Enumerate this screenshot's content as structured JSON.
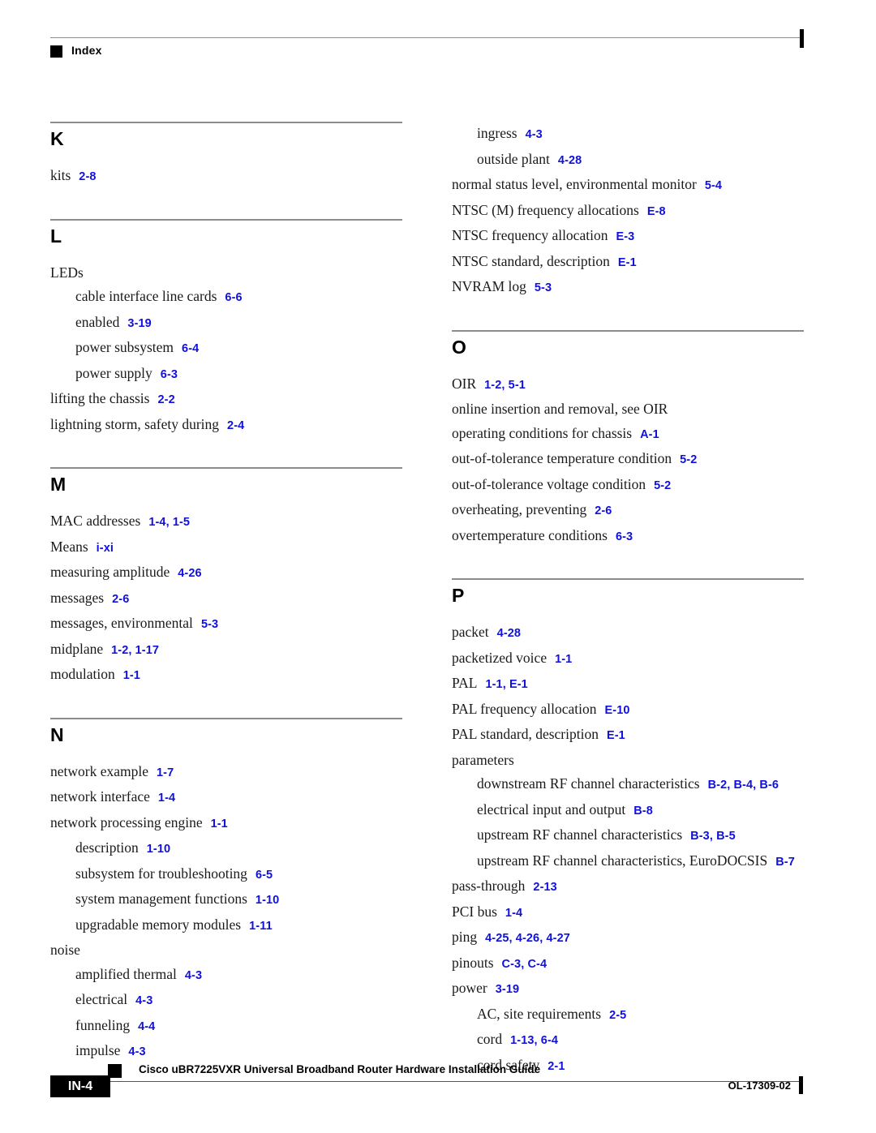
{
  "header": {
    "label": "Index",
    "bullet_icon": "square-bullet-icon"
  },
  "footer": {
    "page_number": "IN-4",
    "guide_title": "Cisco uBR7225VXR Universal Broadband Router Hardware Installation Guide",
    "doc_number": "OL-17309-02",
    "bullet_icon": "square-bullet-icon"
  },
  "colors": {
    "reference_blue": "#1111dd",
    "rule_gray": "#8c8c8c",
    "text_black": "#1a1a1a"
  },
  "columns": {
    "left": [
      {
        "letter": "K",
        "entries": [
          {
            "level": 0,
            "text": "kits",
            "refs": "2-8"
          }
        ]
      },
      {
        "letter": "L",
        "entries": [
          {
            "level": 0,
            "text": "LEDs",
            "refs": ""
          },
          {
            "level": 1,
            "text": "cable interface line cards",
            "refs": "6-6"
          },
          {
            "level": 1,
            "text": "enabled",
            "refs": "3-19"
          },
          {
            "level": 1,
            "text": "power subsystem",
            "refs": "6-4"
          },
          {
            "level": 1,
            "text": "power supply",
            "refs": "6-3"
          },
          {
            "level": 0,
            "text": "lifting the chassis",
            "refs": "2-2"
          },
          {
            "level": 0,
            "text": "lightning storm, safety during",
            "refs": "2-4"
          }
        ]
      },
      {
        "letter": "M",
        "entries": [
          {
            "level": 0,
            "text": "MAC addresses",
            "refs": "1-4, 1-5"
          },
          {
            "level": 0,
            "text": "Means",
            "refs": "i-xi"
          },
          {
            "level": 0,
            "text": "measuring amplitude",
            "refs": "4-26"
          },
          {
            "level": 0,
            "text": "messages",
            "refs": "2-6"
          },
          {
            "level": 0,
            "text": "messages, environmental",
            "refs": "5-3"
          },
          {
            "level": 0,
            "text": "midplane",
            "refs": "1-2, 1-17"
          },
          {
            "level": 0,
            "text": "modulation",
            "refs": "1-1"
          }
        ]
      },
      {
        "letter": "N",
        "entries": [
          {
            "level": 0,
            "text": "network example",
            "refs": "1-7"
          },
          {
            "level": 0,
            "text": "network interface",
            "refs": "1-4"
          },
          {
            "level": 0,
            "text": "network processing engine",
            "refs": "1-1"
          },
          {
            "level": 1,
            "text": "description",
            "refs": "1-10"
          },
          {
            "level": 1,
            "text": "subsystem for troubleshooting",
            "refs": "6-5"
          },
          {
            "level": 1,
            "text": "system management functions",
            "refs": "1-10"
          },
          {
            "level": 1,
            "text": "upgradable memory modules",
            "refs": "1-11"
          },
          {
            "level": 0,
            "text": "noise",
            "refs": ""
          },
          {
            "level": 1,
            "text": "amplified thermal",
            "refs": "4-3"
          },
          {
            "level": 1,
            "text": "electrical",
            "refs": "4-3"
          },
          {
            "level": 1,
            "text": "funneling",
            "refs": "4-4"
          },
          {
            "level": 1,
            "text": "impulse",
            "refs": "4-3"
          }
        ]
      }
    ],
    "right": [
      {
        "letter": "",
        "entries": [
          {
            "level": 1,
            "text": "ingress",
            "refs": "4-3"
          },
          {
            "level": 1,
            "text": "outside plant",
            "refs": "4-28"
          },
          {
            "level": 0,
            "text": "normal status level, environmental monitor",
            "refs": "5-4"
          },
          {
            "level": 0,
            "text": "NTSC (M) frequency allocations",
            "refs": "E-8"
          },
          {
            "level": 0,
            "text": "NTSC frequency allocation",
            "refs": "E-3"
          },
          {
            "level": 0,
            "text": "NTSC standard, description",
            "refs": "E-1"
          },
          {
            "level": 0,
            "text": "NVRAM log",
            "refs": "5-3"
          }
        ]
      },
      {
        "letter": "O",
        "entries": [
          {
            "level": 0,
            "text": "OIR",
            "refs": "1-2, 5-1"
          },
          {
            "level": 0,
            "text": "online insertion and removal, see OIR",
            "refs": ""
          },
          {
            "level": 0,
            "text": "operating conditions for chassis",
            "refs": "A-1"
          },
          {
            "level": 0,
            "text": "out-of-tolerance temperature condition",
            "refs": "5-2"
          },
          {
            "level": 0,
            "text": "out-of-tolerance voltage condition",
            "refs": "5-2"
          },
          {
            "level": 0,
            "text": "overheating, preventing",
            "refs": "2-6"
          },
          {
            "level": 0,
            "text": "overtemperature conditions",
            "refs": "6-3"
          }
        ]
      },
      {
        "letter": "P",
        "entries": [
          {
            "level": 0,
            "text": "packet",
            "refs": "4-28"
          },
          {
            "level": 0,
            "text": "packetized voice",
            "refs": "1-1"
          },
          {
            "level": 0,
            "text": "PAL",
            "refs": "1-1, E-1"
          },
          {
            "level": 0,
            "text": "PAL frequency allocation",
            "refs": "E-10"
          },
          {
            "level": 0,
            "text": "PAL standard, description",
            "refs": "E-1"
          },
          {
            "level": 0,
            "text": "parameters",
            "refs": ""
          },
          {
            "level": 1,
            "text": "downstream RF channel characteristics",
            "refs": "B-2, B-4, B-6"
          },
          {
            "level": 1,
            "text": "electrical input and output",
            "refs": "B-8"
          },
          {
            "level": 1,
            "text": "upstream RF channel characteristics",
            "refs": "B-3, B-5"
          },
          {
            "level": 1,
            "text": "upstream RF channel characteristics, EuroDOCSIS",
            "refs": "B-7",
            "wrap": true
          },
          {
            "level": 0,
            "text": "pass-through",
            "refs": "2-13"
          },
          {
            "level": 0,
            "text": "PCI bus",
            "refs": "1-4"
          },
          {
            "level": 0,
            "text": "ping",
            "refs": "4-25, 4-26, 4-27"
          },
          {
            "level": 0,
            "text": "pinouts",
            "refs": "C-3, C-4"
          },
          {
            "level": 0,
            "text": "power",
            "refs": "3-19"
          },
          {
            "level": 1,
            "text": "AC, site requirements",
            "refs": "2-5"
          },
          {
            "level": 1,
            "text": "cord",
            "refs": "1-13, 6-4"
          },
          {
            "level": 1,
            "text": "cord safety",
            "refs": "2-1"
          }
        ]
      }
    ]
  }
}
